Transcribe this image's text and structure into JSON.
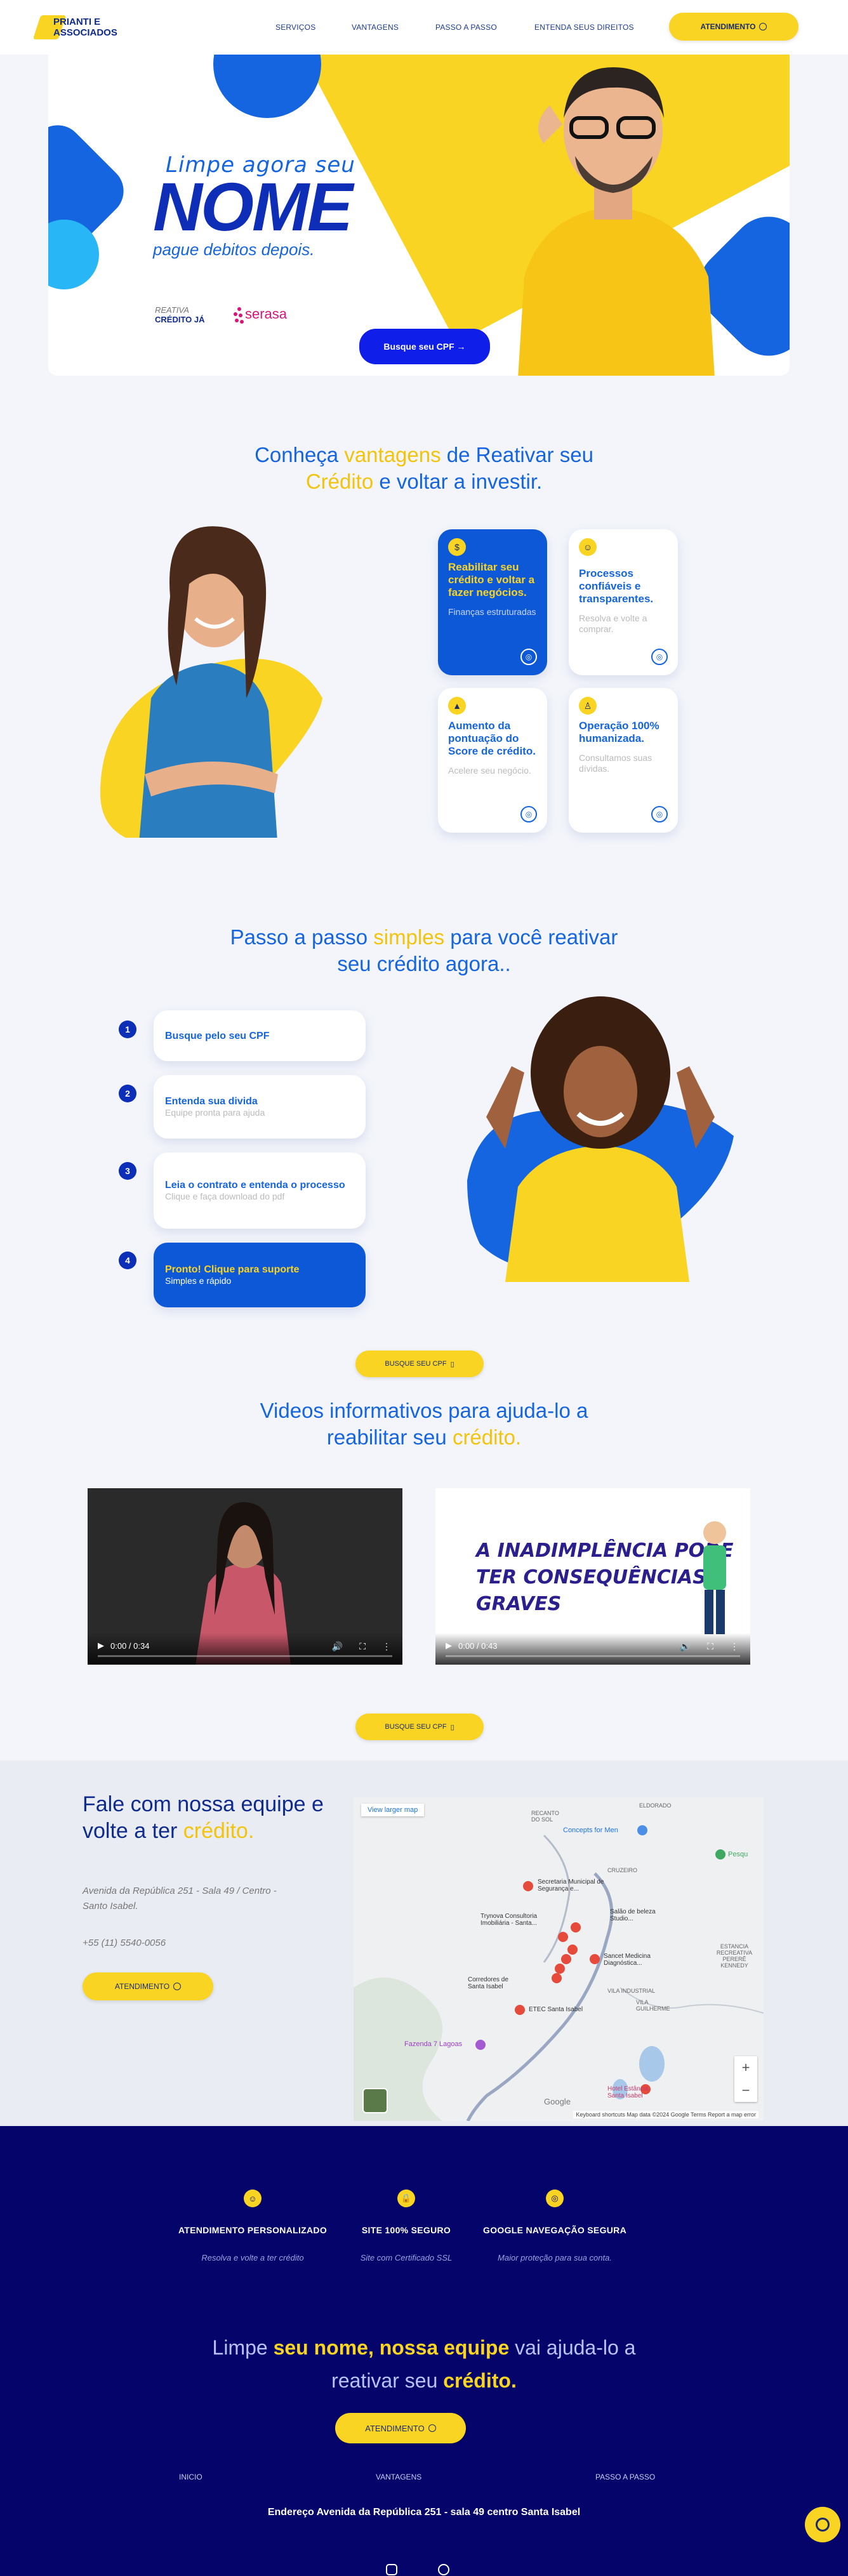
{
  "header": {
    "logo_line1": "PRIANTI E",
    "logo_line2": "ASSOCIADOS",
    "nav": [
      "SERVIÇOS",
      "VANTAGENS",
      "PASSO A PASSO",
      "ENTENDA SEUS DIREITOS"
    ],
    "cta": "ATENDIMENTO"
  },
  "hero": {
    "line1": "Limpe  agora seu",
    "line2": "NOME",
    "line3": "pague debitos depois.",
    "reativa": "REATIVA",
    "credito": "CRÉDITO JÁ",
    "serasa": "serasa",
    "button": "Busque seu CPF →"
  },
  "vantagens": {
    "title_a": "Conheça ",
    "title_b": "vantagens",
    "title_c": " de Reativar seu",
    "title_d": "Crédito",
    "title_e": " e voltar a investir.",
    "cards": [
      {
        "icon": "$",
        "title": "Reabilitar seu crédito e voltar a fazer negócios.",
        "sub": "Finanças estruturadas"
      },
      {
        "icon": "☺",
        "title": "Processos confiáveis e transparentes.",
        "sub": "Resolva e volte a comprar."
      },
      {
        "icon": "▲",
        "title": "Aumento da pontuação do Score de crédito.",
        "sub": "Acelere seu negócio."
      },
      {
        "icon": "♙",
        "title": "Operação 100% humanizada.",
        "sub": "Consultamos suas dívidas."
      }
    ]
  },
  "passos": {
    "title_a": "Passo a passo ",
    "title_b": "simples",
    "title_c": " para você reativar",
    "title_d": "seu crédito agora..",
    "steps": [
      {
        "num": "1",
        "title": "Busque pelo seu CPF",
        "sub": ""
      },
      {
        "num": "2",
        "title": "Entenda sua divida",
        "sub": "Equipe pronta para ajuda"
      },
      {
        "num": "3",
        "title": "Leia o contrato e entenda o processo",
        "sub": "Clique e faça download do pdf"
      },
      {
        "num": "4",
        "title": "Pronto! Clique para suporte",
        "sub": "Simples e rápido"
      }
    ],
    "cta": "BUSQUE SEU CPF"
  },
  "videos": {
    "title_a": "Videos informativos para ajuda-lo a",
    "title_b": "reabilitar seu ",
    "title_c": "crédito.",
    "items": [
      {
        "time": "0:00 / 0:34",
        "overlay_line1": "",
        "overlay_line2": ""
      },
      {
        "time": "0:00 / 0:43",
        "overlay_line1": "A INADIMPLÊNCIA PODE",
        "overlay_line2": "TER CONSEQUÊNCIAS GRAVES"
      }
    ],
    "cta": "BUSQUE SEU CPF"
  },
  "contato": {
    "title_a": "Fale com nossa equipe e volte a ter",
    "title_b": "crédito.",
    "address": "Avenida da República 251 - Sala 49 / Centro - Santo Isabel.",
    "phone": "+55 (11) 5540-0056",
    "cta": "ATENDIMENTO",
    "map": {
      "link": "View larger map",
      "labels": [
        "Concepts for Men",
        "Secretaria Municipal de Segurança e...",
        "Trynova Consultoria Imobiliária - Santa...",
        "Salão de beleza Studio...",
        "Sancet Medicina Diagnóstica...",
        "Corredores de Santa Isabel",
        "ETEC Santa Isabel",
        "Fazenda 7 Lagoas",
        "Hotel Estância Santa Isabel",
        "Pesqu",
        "CRUZEIRO",
        "VILA INDUSTRIAL",
        "VILA GUILHERME",
        "ESTANCIA RECREATIVA PERERÊ KENNEDY",
        "RECANTO DO SOL",
        "ELDORADO",
        "Google"
      ],
      "footer": "Keyboard shortcuts   Map data ©2024 Google   Terms   Report a map error",
      "zoom_in": "+",
      "zoom_out": "−"
    }
  },
  "footer": {
    "features": [
      {
        "icon": "☺",
        "title": "ATENDIMENTO PERSONALIZADO",
        "sub": "Resolva e volte a ter crédito"
      },
      {
        "icon": "🔒",
        "title": "SITE 100% SEGURO",
        "sub": "Site com Certificado SSL"
      },
      {
        "icon": "◎",
        "title": "GOOGLE NAVEGAÇÃO SEGURA",
        "sub": "Maior proteção para sua conta."
      }
    ],
    "slogan_a": "Limpe ",
    "slogan_b": "seu nome, nossa equipe",
    "slogan_c": " vai ajuda-lo a",
    "slogan_d": "reativar seu ",
    "slogan_e": "crédito.",
    "cta": "ATENDIMENTO",
    "links": [
      "INICIO",
      "VANTAGENS",
      "PASSO A PASSO"
    ],
    "address": "Endereço Avenida da República 251 - sala 49 centro Santa Isabel"
  }
}
